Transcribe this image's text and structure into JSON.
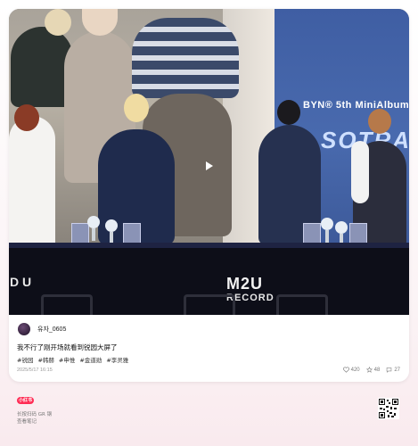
{
  "post": {
    "author_name": "유자_0605",
    "caption": "我不行了刚开场就看到锐园大屏了",
    "tags": [
      "#锐园",
      "#韩赫",
      "#申惟",
      "#金道勋",
      "#李灵雅"
    ],
    "date": "2025/5/17 16:15",
    "likes": "420",
    "favorites": "48",
    "comments": "27"
  },
  "media": {
    "banner_text": "BYN® 5th MiniAlbum",
    "banner_big": "SOTRA",
    "stage_logo_main": "M2U",
    "stage_logo_sub": "RECORD",
    "stage_logo_left": "D U",
    "play_icon": "play-icon"
  },
  "footer": {
    "brand": "小红书",
    "line1": "长按扫码 GR 钢",
    "line2": "查看笔记"
  },
  "colors": {
    "brand_red": "#ff2d55",
    "banner_blue": "#496aae",
    "stage_black": "#0d0e18"
  }
}
